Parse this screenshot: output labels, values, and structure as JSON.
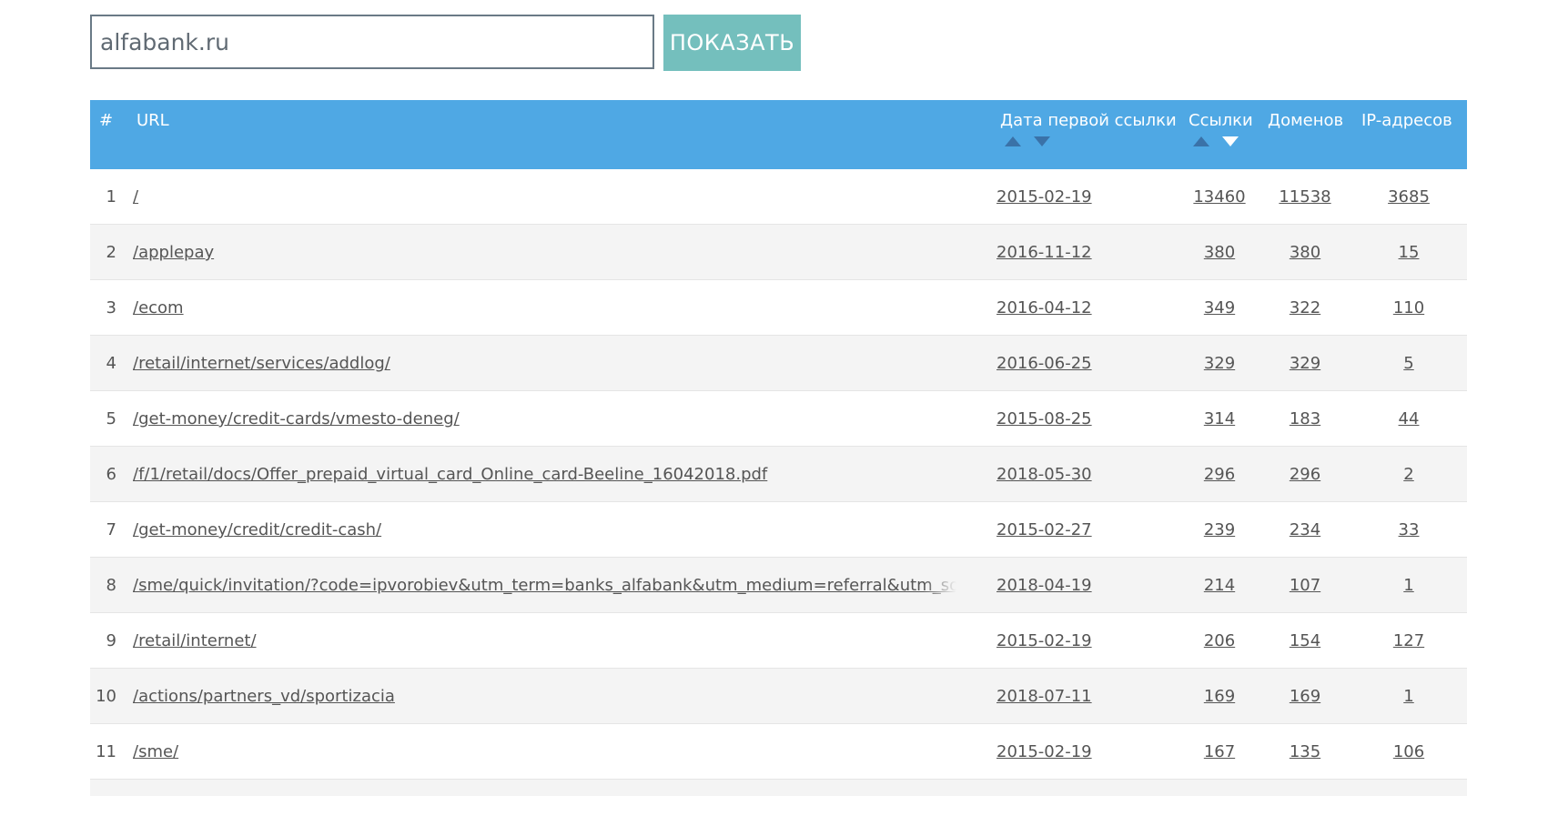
{
  "search": {
    "value": "alfabank.ru",
    "button_label": "ПОКАЗАТЬ"
  },
  "table": {
    "headers": {
      "num": "#",
      "url": "URL",
      "date": "Дата первой ссылки",
      "links": "Ссылки",
      "domains": "Доменов",
      "ips": "IP-адресов"
    },
    "rows": [
      {
        "num": "1",
        "url": "/",
        "date": "2015-02-19",
        "links": "13460",
        "domains": "11538",
        "ips": "3685"
      },
      {
        "num": "2",
        "url": "/applepay",
        "date": "2016-11-12",
        "links": "380",
        "domains": "380",
        "ips": "15"
      },
      {
        "num": "3",
        "url": "/ecom",
        "date": "2016-04-12",
        "links": "349",
        "domains": "322",
        "ips": "110"
      },
      {
        "num": "4",
        "url": "/retail/internet/services/addlog/",
        "date": "2016-06-25",
        "links": "329",
        "domains": "329",
        "ips": "5"
      },
      {
        "num": "5",
        "url": "/get-money/credit-cards/vmesto-deneg/",
        "date": "2015-08-25",
        "links": "314",
        "domains": "183",
        "ips": "44"
      },
      {
        "num": "6",
        "url": "/f/1/retail/docs/Offer_prepaid_virtual_card_Online_card-Beeline_16042018.pdf",
        "date": "2018-05-30",
        "links": "296",
        "domains": "296",
        "ips": "2"
      },
      {
        "num": "7",
        "url": "/get-money/credit/credit-cash/",
        "date": "2015-02-27",
        "links": "239",
        "domains": "234",
        "ips": "33"
      },
      {
        "num": "8",
        "url": "/sme/quick/invitation/?code=ipvorobiev&utm_term=banks_alfabank&utm_medium=referral&utm_source=b",
        "date": "2018-04-19",
        "links": "214",
        "domains": "107",
        "ips": "1"
      },
      {
        "num": "9",
        "url": "/retail/internet/",
        "date": "2015-02-19",
        "links": "206",
        "domains": "154",
        "ips": "127"
      },
      {
        "num": "10",
        "url": "/actions/partners_vd/sportizacia",
        "date": "2018-07-11",
        "links": "169",
        "domains": "169",
        "ips": "1"
      },
      {
        "num": "11",
        "url": "/sme/",
        "date": "2015-02-19",
        "links": "167",
        "domains": "135",
        "ips": "106"
      }
    ]
  },
  "colors": {
    "header_bg": "#4fa8e4",
    "button_bg": "#74bfbd",
    "sort_arrow": "#3a72a8"
  }
}
